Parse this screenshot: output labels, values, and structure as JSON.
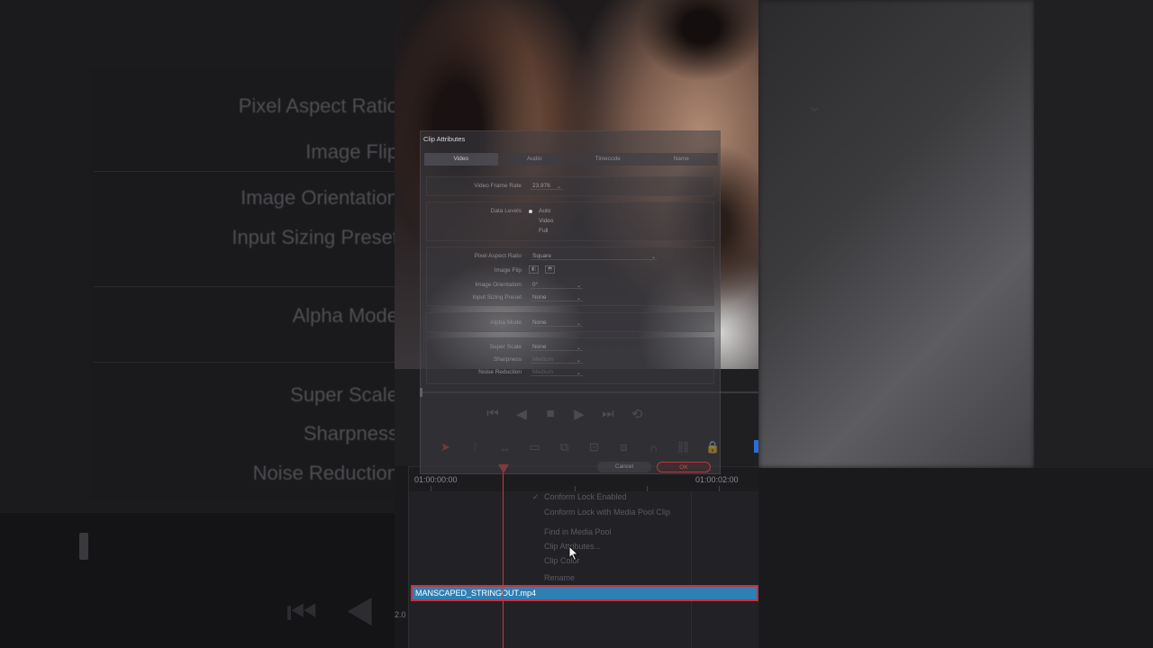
{
  "background": {
    "labels": [
      "Pixel Aspect Ratio",
      "Image Flip",
      "Image Orientation",
      "Input Sizing Preset",
      "Alpha Mode",
      "Super Scale",
      "Sharpness",
      "Noise Reduction"
    ]
  },
  "dialog": {
    "title": "Clip Attributes",
    "tabs": [
      "Video",
      "Audio",
      "Timecode",
      "Name"
    ],
    "active_tab": "Video",
    "video_frame_rate": {
      "label": "Video Frame Rate",
      "value": "23.976"
    },
    "data_levels": {
      "label": "Data Levels",
      "options": [
        "Auto",
        "Video",
        "Full"
      ],
      "selected": "Auto"
    },
    "pixel_aspect_ratio": {
      "label": "Pixel Aspect Ratio",
      "value": "Square"
    },
    "image_flip": {
      "label": "Image Flip"
    },
    "image_orientation": {
      "label": "Image Orientation",
      "value": "0°"
    },
    "input_sizing_preset": {
      "label": "Input Sizing Preset",
      "value": "None"
    },
    "alpha_mode": {
      "label": "Alpha Mode",
      "value": "None"
    },
    "super_scale": {
      "label": "Super Scale",
      "value": "None"
    },
    "sharpness": {
      "label": "Sharpness",
      "value": "Medium"
    },
    "noise_reduction": {
      "label": "Noise Reduction",
      "value": "Medium"
    },
    "cancel_label": "Cancel",
    "ok_label": "OK"
  },
  "timeline": {
    "timecode_start": "01:00:00:00",
    "timecode_end": "01:00:02:00",
    "track_number": "2.0",
    "clip_name": "MANSCAPED_STRINGOUT.mp4"
  },
  "context_menu": {
    "items": [
      "Conform Lock Enabled",
      "Conform Lock with Media Pool Clip",
      "Find in Media Pool",
      "Clip Attributes...",
      "Clip Color",
      "Rename"
    ],
    "checked": "Conform Lock Enabled"
  },
  "colors": {
    "clip_fill": "#2f7fb3",
    "playhead": "#d8333a",
    "ok_accent": "#b33b3f",
    "flag": "#2b6fd6"
  }
}
